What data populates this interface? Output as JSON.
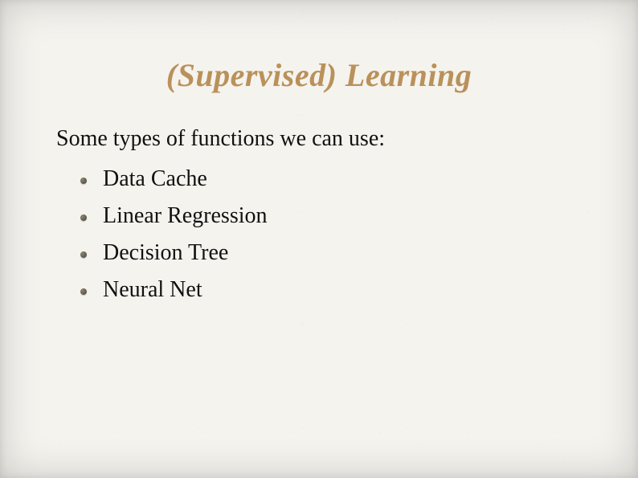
{
  "title": "(Supervised) Learning",
  "intro": "Some types of functions we can use:",
  "items": [
    {
      "label": "Data Cache"
    },
    {
      "label": "Linear Regression"
    },
    {
      "label": "Decision Tree"
    },
    {
      "label": "Neural Net"
    }
  ],
  "colors": {
    "title": "#b9915a",
    "text": "#111111",
    "background": "#f5f3ee"
  }
}
